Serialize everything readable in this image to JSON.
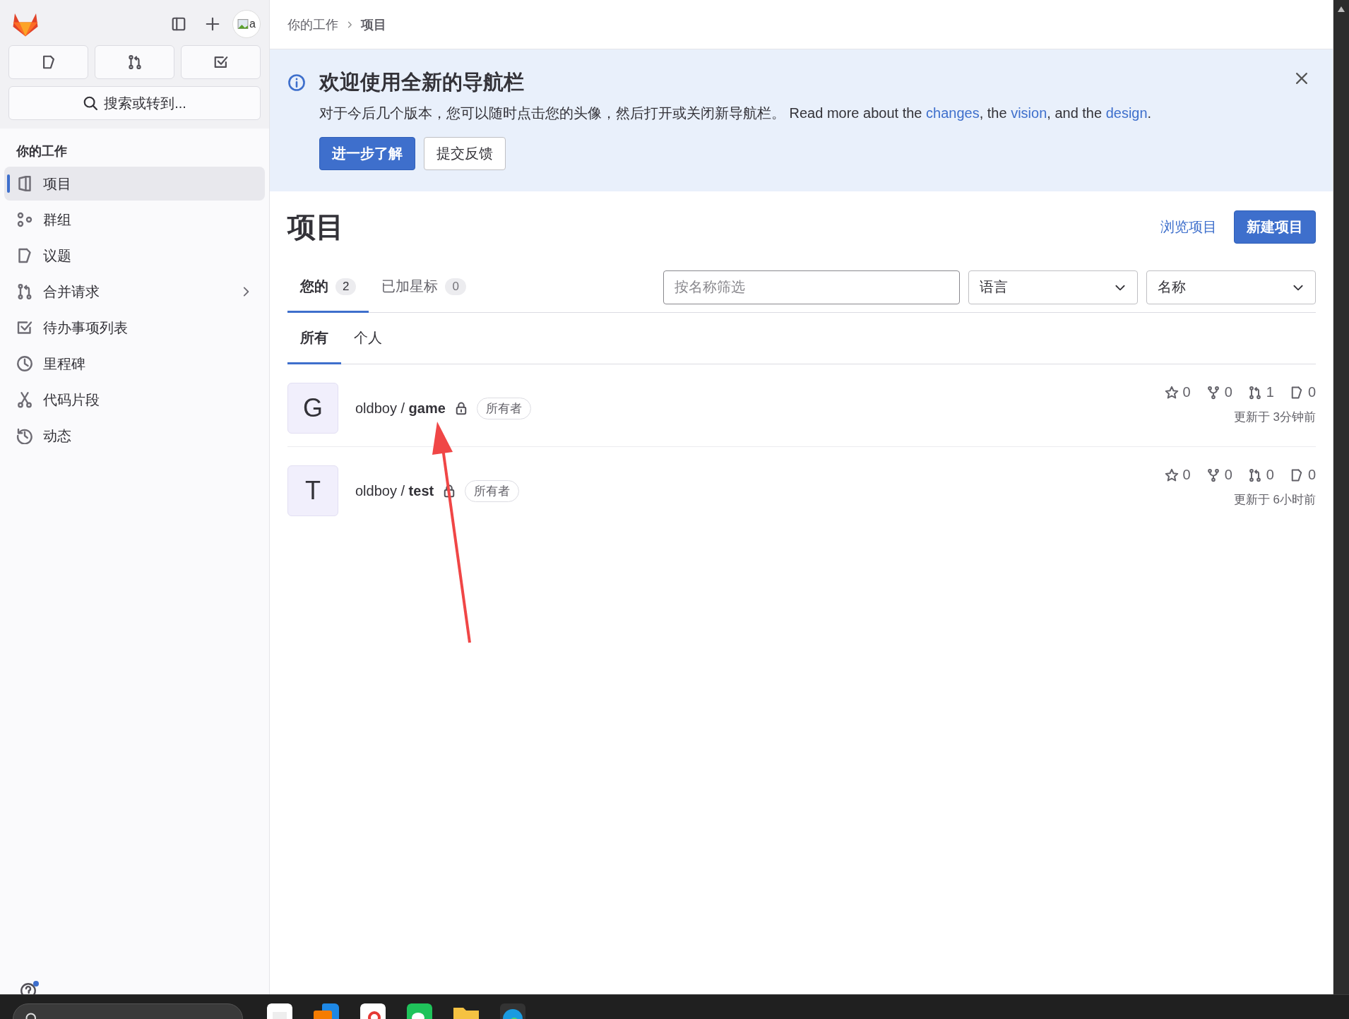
{
  "sidebar": {
    "avatar_alt": "a",
    "search": {
      "label": "搜索或转到..."
    },
    "section_title": "你的工作",
    "items": [
      {
        "label": "项目",
        "selected": true,
        "expandable": false
      },
      {
        "label": "群组",
        "selected": false,
        "expandable": false
      },
      {
        "label": "议题",
        "selected": false,
        "expandable": false
      },
      {
        "label": "合并请求",
        "selected": false,
        "expandable": true
      },
      {
        "label": "待办事项列表",
        "selected": false,
        "expandable": false
      },
      {
        "label": "里程碑",
        "selected": false,
        "expandable": false
      },
      {
        "label": "代码片段",
        "selected": false,
        "expandable": false
      },
      {
        "label": "动态",
        "selected": false,
        "expandable": false
      }
    ],
    "help": {
      "kind": "help"
    }
  },
  "breadcrumb": [
    {
      "label": "你的工作",
      "current": false
    },
    {
      "label": "项目",
      "current": true
    }
  ],
  "banner": {
    "title": "欢迎使用全新的导航栏",
    "text": "对于今后几个版本，您可以随时点击您的头像，然后打开或关闭新导航栏。 Read more about the ",
    "links": [
      {
        "label": "changes",
        "after": ", the "
      },
      {
        "label": "vision",
        "after": ", and the "
      },
      {
        "label": "design",
        "after": "."
      }
    ],
    "buttons": [
      {
        "label": "进一步了解",
        "kind": "primary"
      },
      {
        "label": "提交反馈",
        "kind": "secondary"
      }
    ]
  },
  "page": {
    "title": "项目",
    "actions": [
      {
        "label": "浏览项目",
        "kind": "link"
      },
      {
        "label": "新建项目",
        "kind": "primary"
      }
    ]
  },
  "tabs": [
    {
      "label": "您的",
      "count": "2",
      "selected": true
    },
    {
      "label": "已加星标",
      "count": "0",
      "selected": false
    }
  ],
  "filter": {
    "placeholder": "按名称筛选"
  },
  "dropdowns": [
    {
      "label": "语言"
    },
    {
      "label": "名称"
    }
  ],
  "subtabs": [
    {
      "label": "所有",
      "selected": true
    },
    {
      "label": "个人",
      "selected": false
    }
  ],
  "projects": [
    {
      "initial": "G",
      "namespace": "oldboy / ",
      "name": "game",
      "private": true,
      "role": "所有者",
      "stats": [
        {
          "kind": "stars",
          "value": "0"
        },
        {
          "kind": "forks",
          "value": "0"
        },
        {
          "kind": "merge_requests",
          "value": "1"
        },
        {
          "kind": "issues",
          "value": "0"
        }
      ],
      "updated": "更新于 3分钟前"
    },
    {
      "initial": "T",
      "namespace": "oldboy / ",
      "name": "test",
      "private": true,
      "role": "所有者",
      "stats": [
        {
          "kind": "stars",
          "value": "0"
        },
        {
          "kind": "forks",
          "value": "0"
        },
        {
          "kind": "merge_requests",
          "value": "0"
        },
        {
          "kind": "issues",
          "value": "0"
        }
      ],
      "updated": "更新于 6小时前"
    }
  ],
  "taskbar": {
    "kind": "windows"
  }
}
